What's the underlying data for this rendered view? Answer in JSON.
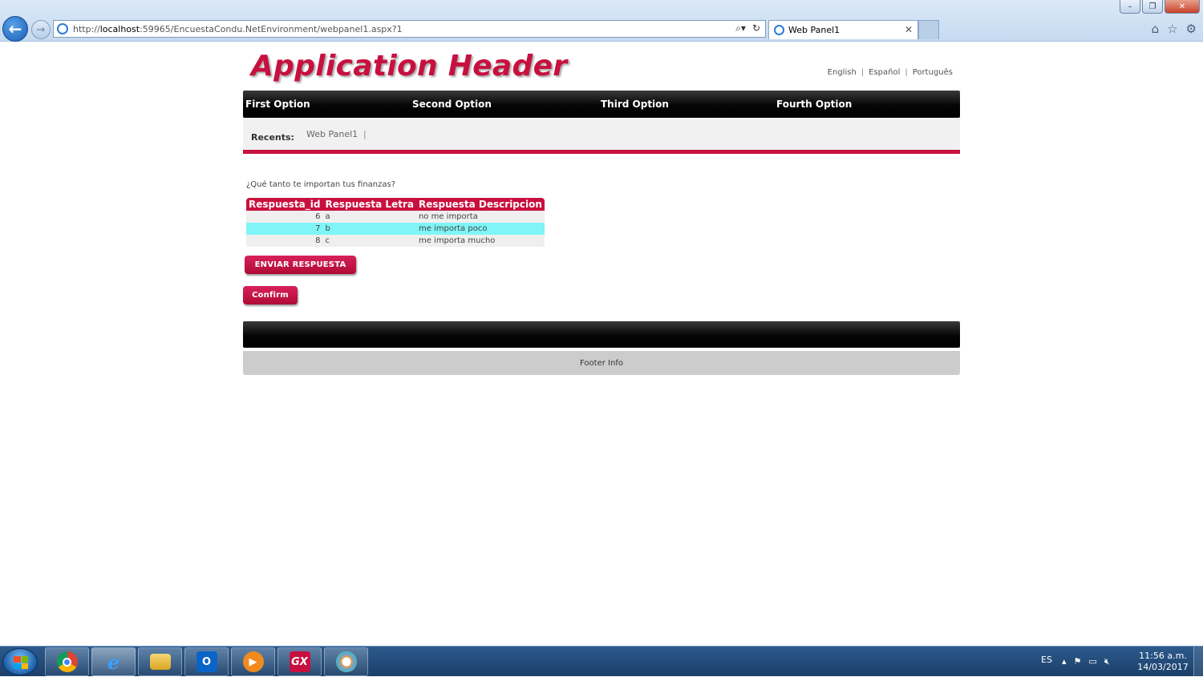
{
  "browser": {
    "url_prefix": "http://",
    "url_host": "localhost",
    "url_rest": ":59965/EncuestaCondu.NetEnvironment/webpanel1.aspx?1",
    "tab_title": "Web Panel1"
  },
  "header": {
    "title": "Application Header",
    "languages": [
      "English",
      "Español",
      "Português"
    ]
  },
  "menu": {
    "items": [
      "First Option",
      "Second Option",
      "Third Option",
      "Fourth Option"
    ]
  },
  "recents": {
    "label": "Recents:",
    "links": [
      "Web Panel1"
    ],
    "separator": "|"
  },
  "survey": {
    "question": "¿Qué tanto te importan tus finanzas?",
    "columns": [
      "Respuesta_id",
      "Respuesta Letra",
      "Respuesta Descripcion"
    ],
    "rows": [
      {
        "id": "6",
        "letra": "a",
        "descripcion": "no me importa"
      },
      {
        "id": "7",
        "letra": "b",
        "descripcion": "me importa poco"
      },
      {
        "id": "8",
        "letra": "c",
        "descripcion": "me importa mucho"
      }
    ],
    "selected_row": 1,
    "send_button": "ENVIAR RESPUESTA",
    "confirm_button": "Confirm"
  },
  "footer": {
    "info": "Footer Info"
  },
  "taskbar": {
    "language": "ES",
    "time": "11:56 a.m.",
    "date": "14/03/2017",
    "gx_label": "GX"
  },
  "colors": {
    "accent": "#c8103f",
    "menu_bg": "#000000",
    "selected_row": "#7ff5f7",
    "footer_info_bg": "#cccccc"
  }
}
